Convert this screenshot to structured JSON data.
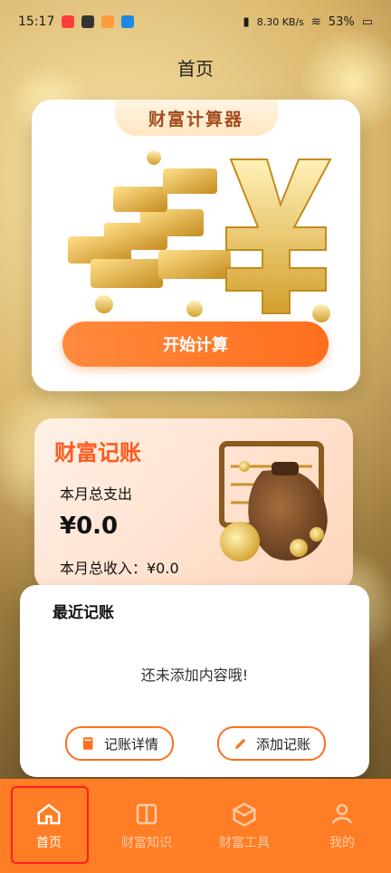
{
  "status": {
    "time": "15:17",
    "net_speed": "8.30 KB/s",
    "battery": "53%"
  },
  "header": {
    "title": "首页"
  },
  "calculator": {
    "tab_label": "财富计算器",
    "start_button": "开始计算"
  },
  "ledger": {
    "title": "财富记账",
    "expense_label": "本月总支出",
    "expense_value": "¥0.0",
    "income_text": "本月总收入：¥0.0"
  },
  "recent": {
    "title": "最近记账",
    "empty_text": "还未添加内容哦!",
    "detail_button": "记账详情",
    "add_button": "添加记账"
  },
  "tabbar": {
    "items": [
      {
        "label": "首页",
        "icon": "home-icon"
      },
      {
        "label": "财富知识",
        "icon": "book-icon"
      },
      {
        "label": "财富工具",
        "icon": "box-icon"
      },
      {
        "label": "我的",
        "icon": "user-icon"
      }
    ]
  },
  "colors": {
    "accent": "#ff7d24",
    "title_orange": "#ff5a1f"
  }
}
